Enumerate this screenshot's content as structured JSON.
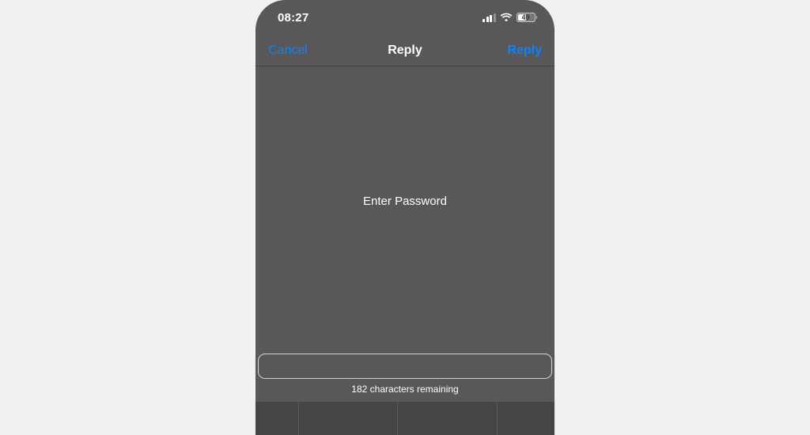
{
  "status": {
    "time": "08:27",
    "battery_percent": "49"
  },
  "nav": {
    "cancel": "Cancel",
    "title": "Reply",
    "action": "Reply"
  },
  "prompt": "Enter Password",
  "input": {
    "value": ""
  },
  "char_count": "182 characters remaining"
}
